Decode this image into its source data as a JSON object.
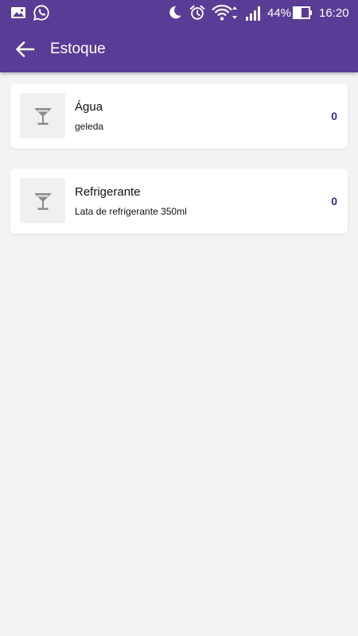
{
  "status_bar": {
    "battery_percent": "44%",
    "time": "16:20",
    "icons": [
      "gallery-icon",
      "whatsapp-icon",
      "moon-icon",
      "alarm-icon",
      "wifi-icon",
      "signal-icon",
      "battery-icon"
    ]
  },
  "app_bar": {
    "title": "Estoque",
    "back_icon": "arrow-back-icon"
  },
  "items": [
    {
      "name": "Água",
      "description": "geleda",
      "quantity": "0",
      "icon": "cocktail-glass-icon"
    },
    {
      "name": "Refrigerante",
      "description": "Lata de refrigerante 350ml",
      "quantity": "0",
      "icon": "cocktail-glass-icon"
    }
  ],
  "colors": {
    "primary": "#593c96",
    "background": "#f3f3f3",
    "quantity_text": "#3f2a86",
    "icon_gray": "#8c8c8c"
  }
}
